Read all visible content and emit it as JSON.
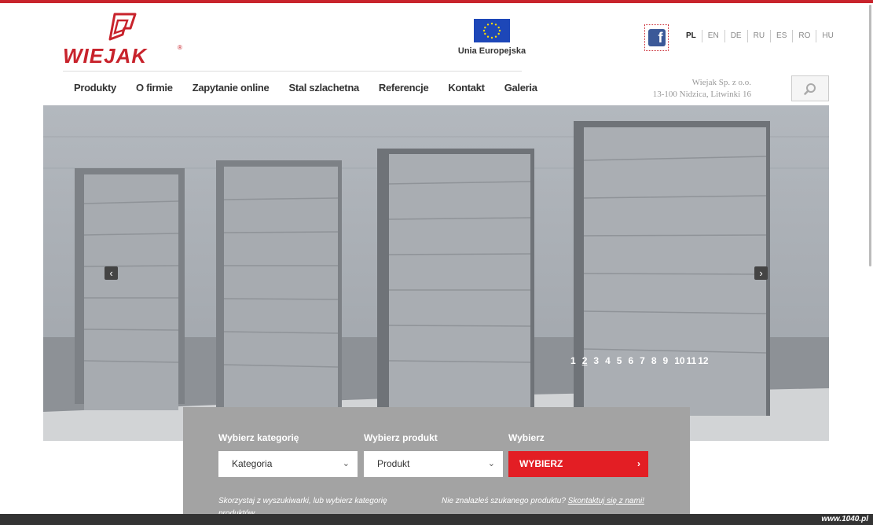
{
  "brand": {
    "name": "WIEJAK",
    "registered": "®",
    "accent_color": "#c8232c"
  },
  "eu": {
    "label": "Unia Europejska",
    "flag_color": "#1d47b8"
  },
  "social": {
    "facebook_icon": "facebook-icon",
    "glyph": "f"
  },
  "languages": [
    {
      "code": "PL",
      "active": true
    },
    {
      "code": "EN",
      "active": false
    },
    {
      "code": "DE",
      "active": false
    },
    {
      "code": "RU",
      "active": false
    },
    {
      "code": "ES",
      "active": false
    },
    {
      "code": "RO",
      "active": false
    },
    {
      "code": "HU",
      "active": false
    }
  ],
  "nav": {
    "items": [
      "Produkty",
      "O firmie",
      "Zapytanie online",
      "Stal szlachetna",
      "Referencje",
      "Kontakt",
      "Galeria"
    ]
  },
  "address": {
    "line1": "Wiejak Sp. z o.o.",
    "line2": "13-100 Nidzica, Litwinki 16"
  },
  "search": {
    "icon": "search-icon",
    "glyph": "⚲"
  },
  "slider": {
    "prev_glyph": "‹",
    "next_glyph": "›",
    "pages": [
      "1",
      "2",
      "3",
      "4",
      "5",
      "6",
      "7",
      "8",
      "9",
      "10",
      "11",
      "12"
    ],
    "active_page": "2"
  },
  "finder": {
    "category_label": "Wybierz kategorię",
    "category_value": "Kategoria",
    "product_label": "Wybierz produkt",
    "product_value": "Produkt",
    "choose_label": "Wybierz",
    "choose_button": "WYBIERZ",
    "caret_glyph": "⌄",
    "button_arrow": "›",
    "hint_left": "Skorzystaj z wyszukiwarki, lub wybierz kategorię produktów",
    "hint_right_prefix": "Nie znalazłeś szukanego produktu?",
    "hint_right_link": "Skontaktuj się z nami!",
    "button_color": "#e31e24"
  },
  "watermark": "www.1040.pl"
}
